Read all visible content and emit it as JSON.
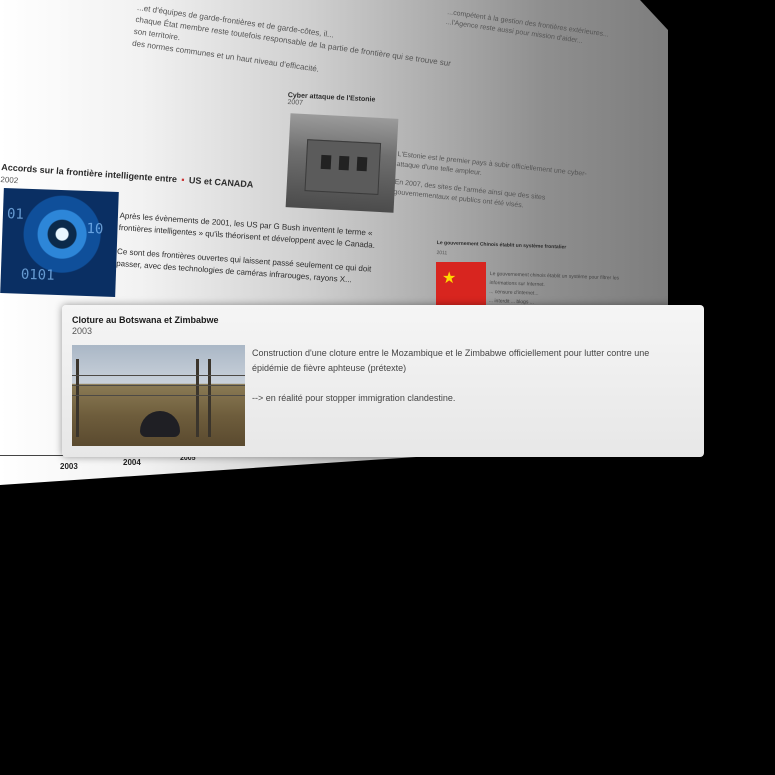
{
  "background_panel": {
    "top_paragraph_lines": [
      "...et d'équipes de garde-frontières et de garde-côtes, il...",
      "chaque État membre reste toutefois responsable de la partie de frontière qui se trouve sur son territoire.",
      "des normes communes et un haut niveau d'efficacité."
    ],
    "right_paragraph_lines": [
      "...compétent à la gestion des frontières extérieures...",
      "...l'Agence reste aussi pour mission d'aider..."
    ]
  },
  "entry_cyber": {
    "title": "Cyber attaque de l'Estonie",
    "year": "2007",
    "text_lines": [
      "L'Estonie est le premier pays à subir officiellement une cyber-attaque d'une telle ampleur.",
      "En 2007, des sites de l'armée ainsi que des sites gouvernementaux et publics ont été visés."
    ]
  },
  "entry_smart_border": {
    "title": "Accords sur la frontière intelligente entre",
    "title_flags": "US et CANADA",
    "year": "2002",
    "paragraph_1": "Après les évènements de 2001, les US par G Bush inventent le terme « frontières intelligentes » qu'ils théorisent et développent avec le Canada.",
    "paragraph_2": "Ce sont des frontières ouvertes qui laissent passé seulement ce qui doit passer, avec des technologies de caméras infrarouges, rayons X..."
  },
  "entry_china": {
    "title": "Le gouvernement Chinois établit un système frontalier",
    "year": "2011",
    "text_lines": [
      "Le gouvernement chinois établit un système pour filtrer les informations sur Internet.",
      "... censure d'internet...",
      "... interdit ... blogs ..."
    ]
  },
  "focused_card": {
    "title": "Cloture au Botswana et Zimbabwe",
    "year": "2003",
    "paragraph_1": "Construction d'une cloture entre le Mozambique et le Zimbabwe officiellement pour lutter contre une épidémie de fièvre aphteuse (prétexte)",
    "paragraph_2": "--> en réalité pour stopper immigration clandestine."
  },
  "axis": {
    "labels": [
      "2003",
      "2004",
      "2005"
    ]
  },
  "colors": {
    "background": "#000000",
    "card_bg": "#eeeeee",
    "flag_red": "#d8251f"
  }
}
